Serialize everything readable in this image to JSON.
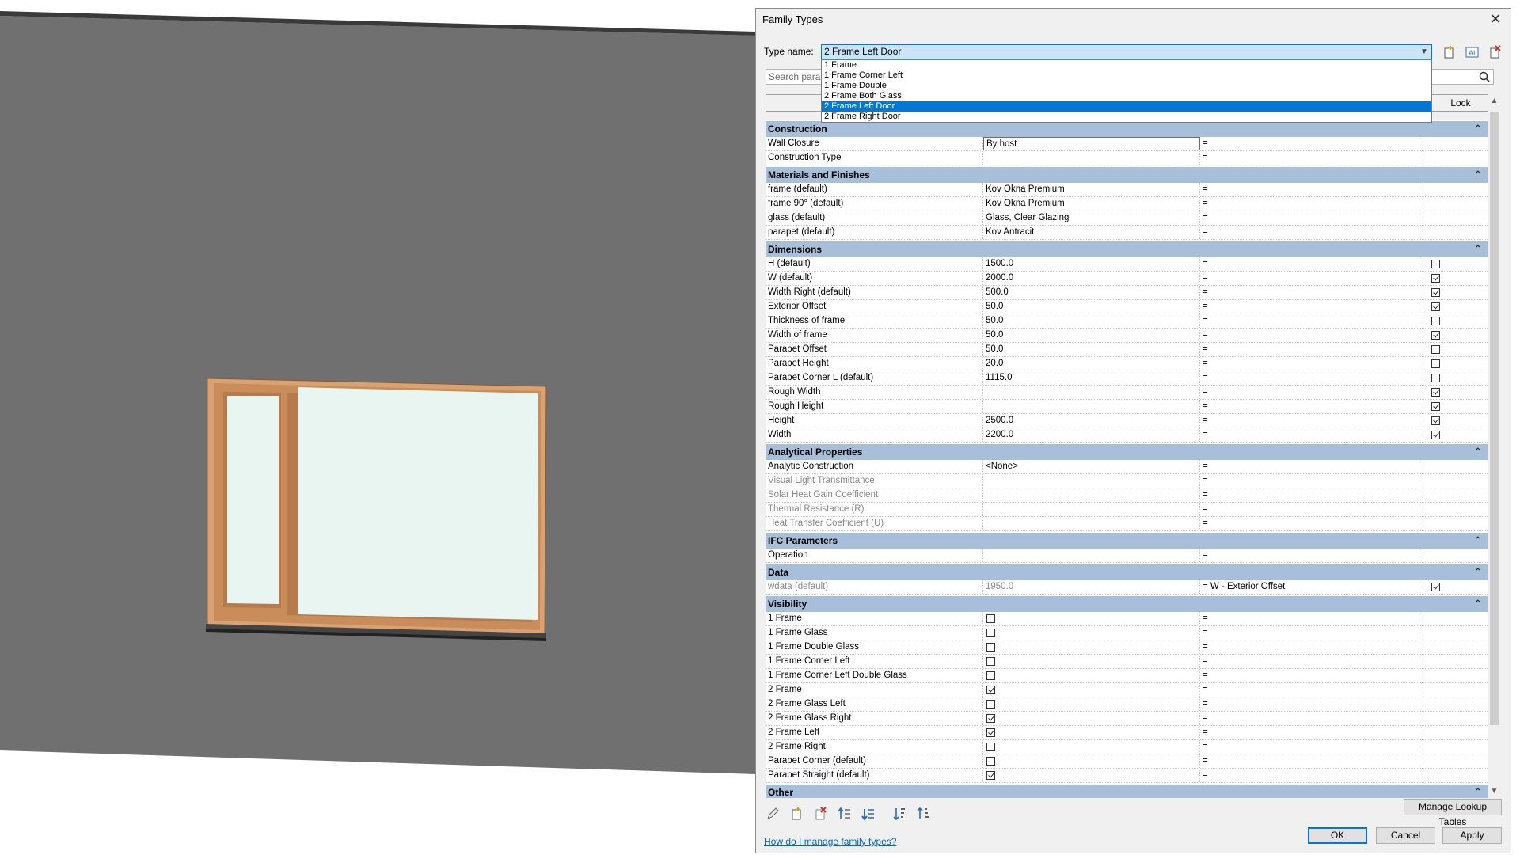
{
  "dialog": {
    "title": "Family Types",
    "type_name_label": "Type name:",
    "type_name_value": "2 Frame Left Door",
    "search_placeholder": "Search parameters",
    "lock_header": "Lock",
    "dropdown_options": [
      {
        "label": "1 Frame",
        "selected": false
      },
      {
        "label": "1 Frame Corner Left",
        "selected": false
      },
      {
        "label": "1 Frame Double",
        "selected": false
      },
      {
        "label": "2 Frame Both Glass",
        "selected": false
      },
      {
        "label": "2 Frame Left Door",
        "selected": true
      },
      {
        "label": "2 Frame Right Door",
        "selected": false
      }
    ],
    "groups": [
      {
        "name": "Construction",
        "rows": [
          {
            "param": "Wall Closure",
            "value": "By host",
            "formula": "=",
            "editing": true
          },
          {
            "param": "Construction Type",
            "value": "",
            "formula": "="
          }
        ]
      },
      {
        "name": "Materials and Finishes",
        "rows": [
          {
            "param": "frame (default)",
            "value": "Kov Okna Premium",
            "formula": "="
          },
          {
            "param": "frame 90° (default)",
            "value": "Kov Okna Premium",
            "formula": "="
          },
          {
            "param": "glass (default)",
            "value": "Glass, Clear Glazing",
            "formula": "="
          },
          {
            "param": "parapet (default)",
            "value": "Kov Antracit",
            "formula": "="
          }
        ]
      },
      {
        "name": "Dimensions",
        "rows": [
          {
            "param": "H (default)",
            "value": "1500.0",
            "formula": "=",
            "lock": false
          },
          {
            "param": "W (default)",
            "value": "2000.0",
            "formula": "=",
            "lock": true
          },
          {
            "param": "Width Right (default)",
            "value": "500.0",
            "formula": "=",
            "lock": true
          },
          {
            "param": "Exterior Offset",
            "value": "50.0",
            "formula": "=",
            "lock": true
          },
          {
            "param": "Thickness of frame",
            "value": "50.0",
            "formula": "=",
            "lock": false
          },
          {
            "param": "Width of frame",
            "value": "50.0",
            "formula": "=",
            "lock": true
          },
          {
            "param": "Parapet Offset",
            "value": "50.0",
            "formula": "=",
            "lock": false
          },
          {
            "param": "Parapet Height",
            "value": "20.0",
            "formula": "=",
            "lock": false
          },
          {
            "param": "Parapet Corner L (default)",
            "value": "1115.0",
            "formula": "=",
            "lock": false
          },
          {
            "param": "Rough Width",
            "value": "",
            "formula": "=",
            "lock": true
          },
          {
            "param": "Rough Height",
            "value": "",
            "formula": "=",
            "lock": true
          },
          {
            "param": "Height",
            "value": "2500.0",
            "formula": "=",
            "lock": true
          },
          {
            "param": "Width",
            "value": "2200.0",
            "formula": "=",
            "lock": true
          }
        ]
      },
      {
        "name": "Analytical Properties",
        "rows": [
          {
            "param": "Analytic Construction",
            "value": "<None>",
            "formula": "="
          },
          {
            "param": "Visual Light Transmittance",
            "value": "",
            "formula": "=",
            "grey": true
          },
          {
            "param": "Solar Heat Gain Coefficient",
            "value": "",
            "formula": "=",
            "grey": true
          },
          {
            "param": "Thermal Resistance (R)",
            "value": "",
            "formula": "=",
            "grey": true
          },
          {
            "param": "Heat Transfer Coefficient (U)",
            "value": "",
            "formula": "=",
            "grey": true
          }
        ]
      },
      {
        "name": "IFC Parameters",
        "rows": [
          {
            "param": "Operation",
            "value": "",
            "formula": "="
          }
        ]
      },
      {
        "name": "Data",
        "rows": [
          {
            "param": "wdata (default)",
            "value": "1950.0",
            "formula": "= W - Exterior Offset",
            "grey": true,
            "lock": true
          }
        ]
      },
      {
        "name": "Visibility",
        "rows": [
          {
            "param": "1 Frame",
            "check": false,
            "formula": "="
          },
          {
            "param": "1 Frame Glass",
            "check": false,
            "formula": "="
          },
          {
            "param": "1 Frame Double Glass",
            "check": false,
            "formula": "="
          },
          {
            "param": "1 Frame Corner Left",
            "check": false,
            "formula": "="
          },
          {
            "param": "1 Frame Corner Left Double Glass",
            "check": false,
            "formula": "="
          },
          {
            "param": "2 Frame",
            "check": true,
            "formula": "="
          },
          {
            "param": "2 Frame Glass Left",
            "check": false,
            "formula": "="
          },
          {
            "param": "2 Frame Glass Right",
            "check": true,
            "formula": "="
          },
          {
            "param": "2 Frame Left",
            "check": true,
            "formula": "="
          },
          {
            "param": "2 Frame Right",
            "check": false,
            "formula": "="
          },
          {
            "param": "Parapet Corner (default)",
            "check": false,
            "formula": "="
          },
          {
            "param": "Parapet Straight (default)",
            "check": true,
            "formula": "="
          }
        ]
      },
      {
        "name": "Other",
        "rows": []
      }
    ],
    "buttons": {
      "manage_lookup": "Manage Lookup Tables",
      "ok": "OK",
      "cancel": "Cancel",
      "apply": "Apply"
    },
    "help_link": "How do I manage family types?",
    "icons": {
      "new_type": "new-type-icon",
      "rename_type": "rename-type-icon",
      "delete_type": "delete-type-icon",
      "edit_param": "pencil-icon",
      "new_param": "new-parameter-icon",
      "delete_param": "delete-parameter-icon",
      "move_up": "move-up-icon",
      "move_down": "move-down-icon",
      "sort_asc": "sort-ascending-icon",
      "sort_desc": "sort-descending-icon",
      "search": "search-icon"
    }
  },
  "colors": {
    "group_header": "#a7bfd8",
    "selection": "#0078d7",
    "wall": "#6f6f6f",
    "frame": "#d9a272",
    "glass": "#e9f5f0"
  }
}
